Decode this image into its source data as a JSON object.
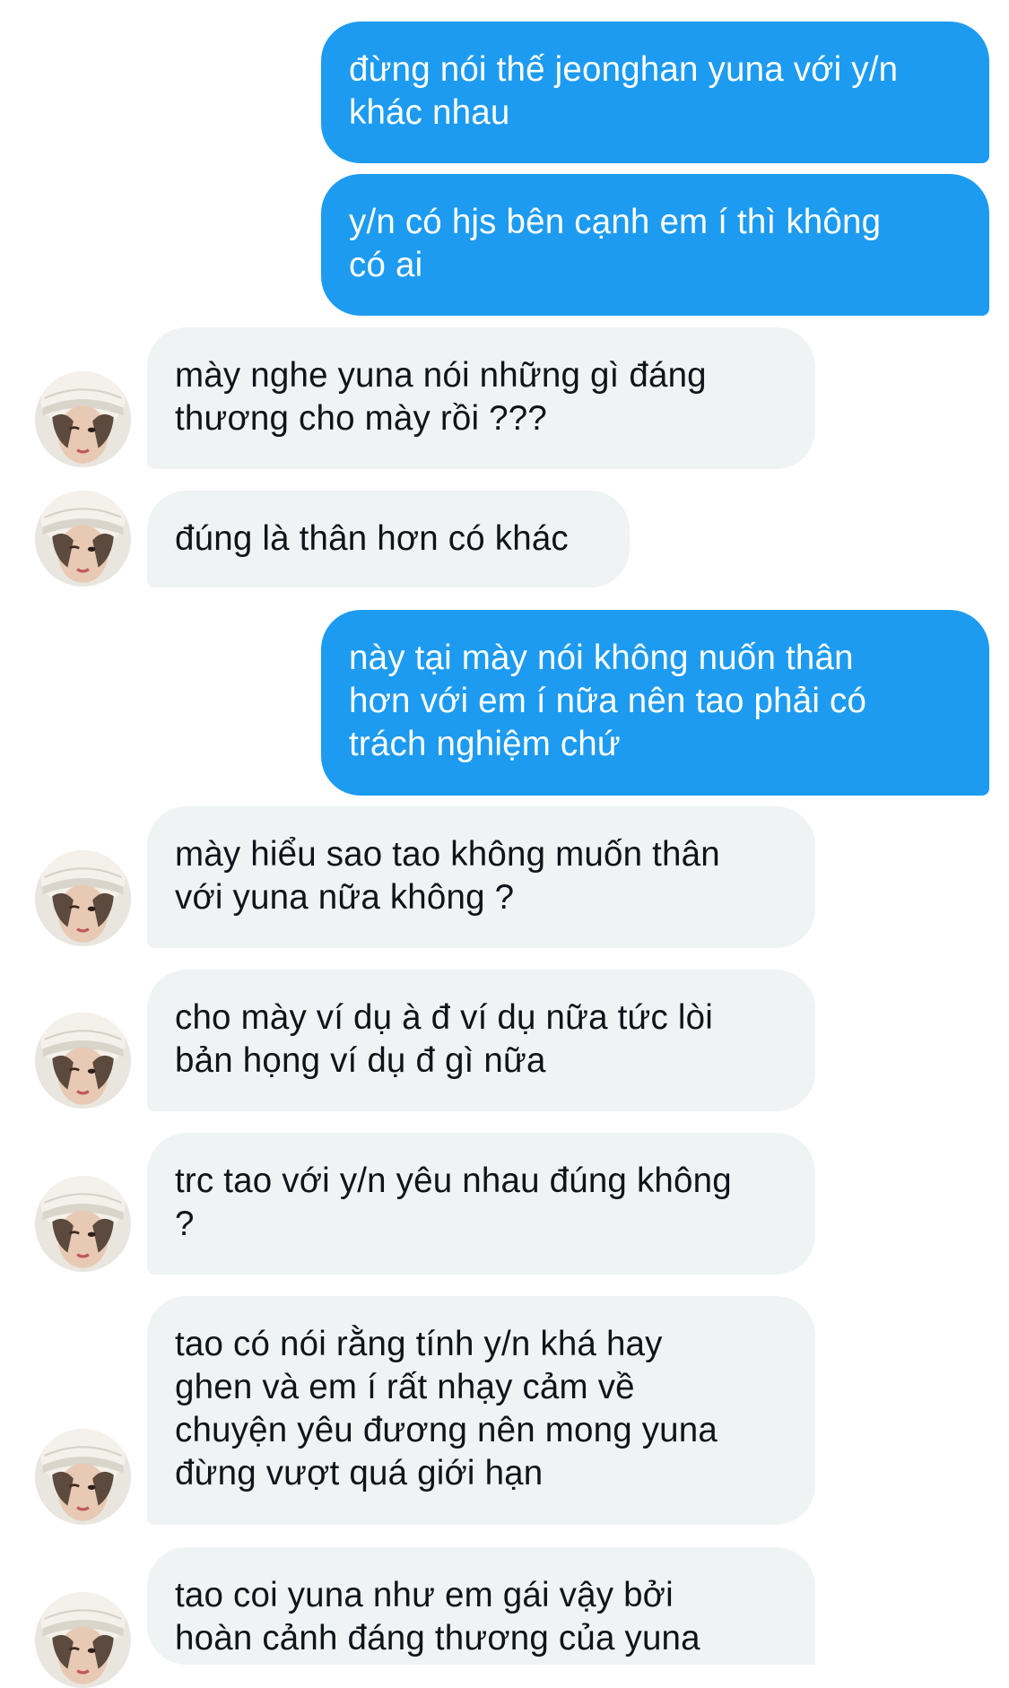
{
  "conversation": {
    "messages": [
      {
        "sender": "me",
        "text": "đừng nói thế jeonghan yuna với y/n\nkhác nhau"
      },
      {
        "sender": "me",
        "text": "y/n có hjs bên cạnh em í thì không\ncó ai"
      },
      {
        "sender": "them",
        "text": "mày nghe yuna nói những gì đáng\nthương cho mày rồi ???",
        "avatar_icon": "profile-avatar"
      },
      {
        "sender": "them",
        "text": "đúng là thân hơn có khác",
        "avatar_icon": "profile-avatar"
      },
      {
        "sender": "me",
        "text": "này tại mày nói không nuốn thân\nhơn với em í nữa nên tao phải có\ntrách nghiệm chứ"
      },
      {
        "sender": "them",
        "text": "mày hiểu sao tao không muốn thân\nvới yuna nữa không ?",
        "avatar_icon": "profile-avatar"
      },
      {
        "sender": "them",
        "text": "cho mày ví dụ à đ ví dụ nữa tức lòi\nbản họng ví dụ đ gì nữa",
        "avatar_icon": "profile-avatar"
      },
      {
        "sender": "them",
        "text": "trc tao với y/n yêu nhau đúng không\n?",
        "avatar_icon": "profile-avatar"
      },
      {
        "sender": "them",
        "text": "tao có nói rằng tính y/n khá hay\nghen và em í rất nhạy cảm về\nchuyện yêu đương nên mong yuna\nđừng vượt quá giới hạn",
        "avatar_icon": "profile-avatar"
      },
      {
        "sender": "them",
        "text": "tao coi yuna như em gái vậy bởi\nhoàn cảnh đáng thương của yuna",
        "avatar_icon": "profile-avatar"
      }
    ]
  },
  "colors": {
    "outgoing_bubble": "#1d9bf0",
    "incoming_bubble": "#eff3f4",
    "outgoing_text": "#ffffff",
    "incoming_text": "#0f1419",
    "background": "#ffffff"
  }
}
